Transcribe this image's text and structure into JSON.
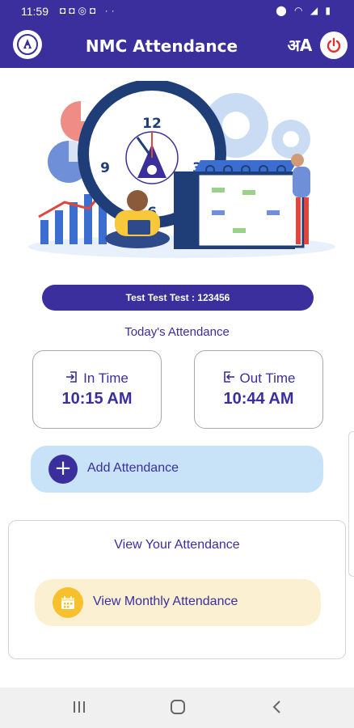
{
  "status_bar": {
    "time": "11:59",
    "left_icons": [
      "instagram-icon",
      "instagram-icon",
      "whatsapp-icon",
      "instagram-icon",
      "more-dots-icon"
    ],
    "right_icons": [
      "location-icon",
      "volte-icon",
      "wifi-icon",
      "signal-icon",
      "battery-icon"
    ]
  },
  "app_bar": {
    "title": "NMC Attendance",
    "language_icon": "अA",
    "background_color": "#3a2f9c"
  },
  "user": {
    "label": "Test Test Test : 123456"
  },
  "attendance": {
    "heading": "Today's Attendance",
    "in_label": "In Time",
    "in_value": "10:15 AM",
    "out_label": "Out Time",
    "out_value": "10:44 AM"
  },
  "actions": {
    "add_label": "Add Attendance",
    "add_icon": "+"
  },
  "view": {
    "heading": "View Your Attendance",
    "monthly_label": "View Monthly Attendance"
  },
  "hero": {
    "clock_numbers": [
      "12",
      "3",
      "6",
      "9"
    ]
  },
  "colors": {
    "primary": "#3a2f9c",
    "add_button_bg": "#c8e2f8",
    "monthly_button_bg": "#fbf0d2",
    "calendar_icon_bg": "#f8c02c",
    "power_icon": "#e0332e"
  }
}
